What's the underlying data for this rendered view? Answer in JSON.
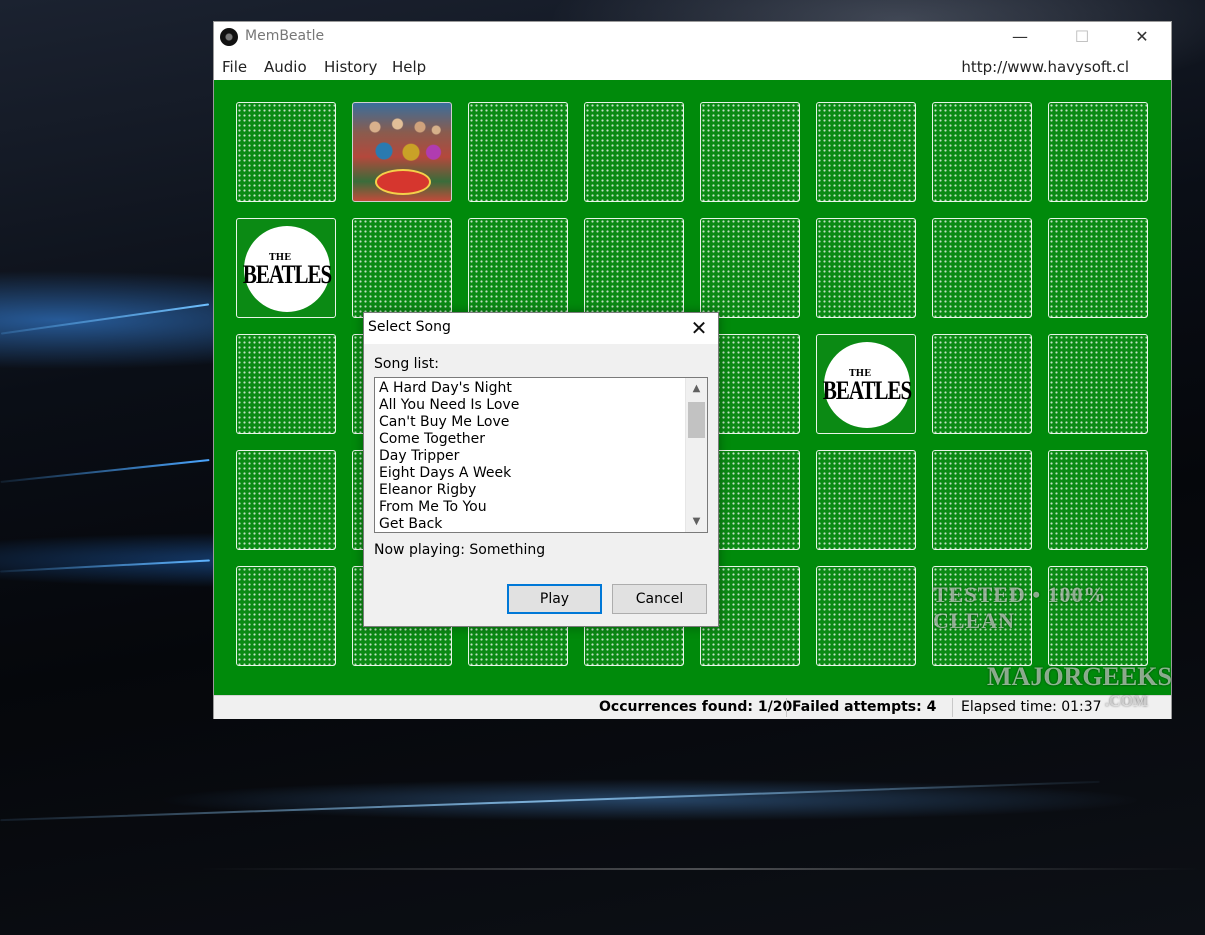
{
  "window": {
    "title": "MemBeatle",
    "controls": {
      "minimize": "—",
      "maximize": "☐",
      "close": "✕"
    }
  },
  "menu": {
    "items": [
      "File",
      "Audio",
      "History",
      "Help"
    ],
    "url": "http://www.havysoft.cl"
  },
  "board": {
    "rows": 5,
    "cols": 8,
    "revealed": [
      {
        "row": 0,
        "col": 1,
        "face": "album-cover"
      },
      {
        "row": 1,
        "col": 0,
        "face": "beatles-logo"
      },
      {
        "row": 2,
        "col": 5,
        "face": "beatles-logo"
      }
    ],
    "logo_the": "THE",
    "logo_name": "BEATLES"
  },
  "dialog": {
    "title": "Select Song",
    "close": "✕",
    "list_label": "Song list:",
    "songs": [
      "A Hard Day's Night",
      "All You Need Is Love",
      "Can't Buy Me Love",
      "Come Together",
      "Day Tripper",
      "Eight Days A Week",
      "Eleanor Rigby",
      "From Me To You",
      "Get Back"
    ],
    "scroll_up": "▲",
    "scroll_down": "▼",
    "now_playing": "Now playing: Something",
    "play_label": "Play",
    "cancel_label": "Cancel"
  },
  "status": {
    "occurrences": "Occurrences found: 1/20",
    "failed": "Failed attempts: 4",
    "elapsed": "Elapsed time: 01:37"
  },
  "watermark": {
    "line1": "TESTED • 100% CLEAN",
    "line2": "MAJORGEEKS",
    "line3": ".COM"
  },
  "colors": {
    "board_green": "#008a0b",
    "dialog_bg": "#f0f0f0",
    "primary_button_border": "#0078d7"
  }
}
